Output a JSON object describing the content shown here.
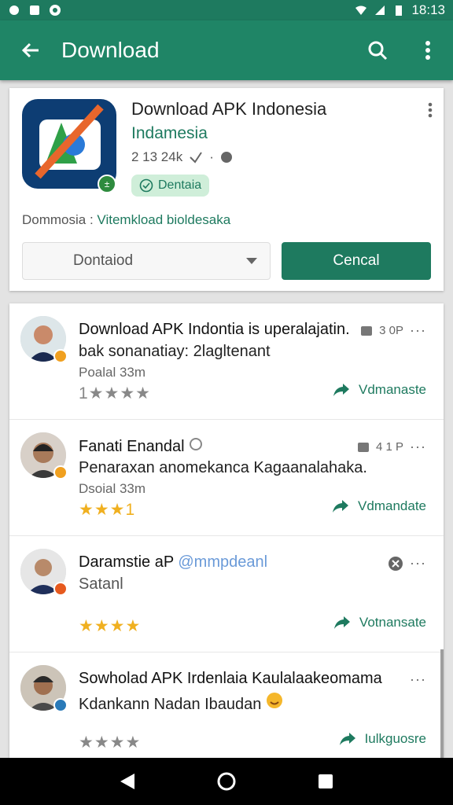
{
  "status": {
    "time": "18:13"
  },
  "app_bar": {
    "title": "Download"
  },
  "app": {
    "name": "Download APK Indonesia",
    "developer": "Indamesia",
    "meta": "2 13 24k",
    "tag": "Dentaia",
    "desc_prefix": "Dommosia :",
    "desc_link": "Vitemkload bioldesaka",
    "dropdown": "Dontaiod",
    "cancel_label": "Cencal",
    "colors": {
      "primary": "#1f8566",
      "icon_bg": "#0d3d73"
    }
  },
  "items": [
    {
      "title": "Download APK Indontia is uperalajatin.",
      "line2": "bak sonanatiay: 2lagltenant",
      "line3": "Poalal 33m",
      "stars_text": "1★★★★",
      "top_right": "3 0P",
      "action": "Vdmanaste",
      "badge_color": "#f0a020",
      "avatar_color": "#c98a6a"
    },
    {
      "title": "Fanati Enandal",
      "line2": "Penaraxan anomekanca Kagaanalahaka.",
      "line3": "Dsoial 33m",
      "stars_text": "★★★1",
      "top_right": "4 1 P",
      "action": "Vdmandate",
      "badge_color": "#f0a020",
      "avatar_color": "#a87a5a"
    },
    {
      "title": "Daramstie aP",
      "title_link": "@mmpdeanl",
      "line2": "Satanl",
      "line3": "",
      "stars_text": "★★★★",
      "top_right": "",
      "action": "Votnansate",
      "badge_color": "#e65a1e",
      "avatar_color": "#b88a6a"
    },
    {
      "title": "Sowholad APK Irdenlaia Kaulalaakeomama",
      "line2": "Kdankann Nadan Ibaudan",
      "line3": "",
      "stars_text": "★★★★",
      "top_right": "",
      "action": "Iulkguosre",
      "badge_color": "#2a7ab8",
      "avatar_color": "#a07050"
    }
  ]
}
